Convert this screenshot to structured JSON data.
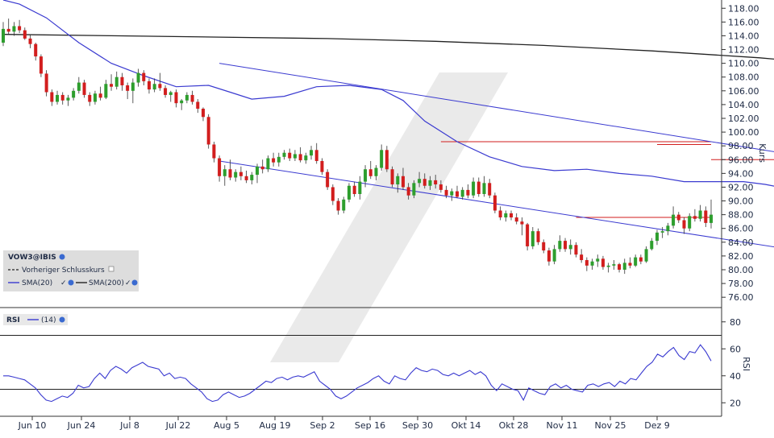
{
  "chart_data": {
    "type": "candlestick",
    "symbol_label": "VOW3@IBIS",
    "price_axis_title": "Kurs",
    "price_axis_ticks": [
      "76.00",
      "78.00",
      "80.00",
      "82.00",
      "84.00",
      "86.00",
      "88.00",
      "90.00",
      "92.00",
      "94.00",
      "96.00",
      "98.00",
      "100.00",
      "102.00",
      "104.00",
      "106.00",
      "108.00",
      "110.00",
      "112.00",
      "114.00",
      "116.00",
      "118.00"
    ],
    "price_ylim": [
      74.5,
      119.2
    ],
    "x_ticks": [
      "Jun 10",
      "Jun 24",
      "Jul 8",
      "Jul 22",
      "Aug 5",
      "Aug 19",
      "Sep 2",
      "Sep 16",
      "Sep 30",
      "Okt 14",
      "Okt 28",
      "Nov 11",
      "Nov 25",
      "Dez 9"
    ],
    "legend": {
      "prev_close": "Vorheriger Schlusskurs",
      "sma20": "SMA(20)",
      "sma200": "SMA(200)"
    },
    "colors": {
      "up": "#2e9e2e",
      "down": "#d21e1e",
      "sma20": "#3a3ad0",
      "sma200": "#222222",
      "channel": "#3a3ad0",
      "resistance": "#d21e1e",
      "rsi": "#3a3ad0"
    },
    "candles": [
      {
        "o": 113.0,
        "h": 116.0,
        "l": 112.5,
        "c": 115.0
      },
      {
        "o": 115.0,
        "h": 116.5,
        "l": 114.2,
        "c": 114.6
      },
      {
        "o": 114.6,
        "h": 116.0,
        "l": 114.0,
        "c": 115.4
      },
      {
        "o": 115.4,
        "h": 116.3,
        "l": 114.4,
        "c": 114.8
      },
      {
        "o": 114.8,
        "h": 115.2,
        "l": 113.4,
        "c": 113.6
      },
      {
        "o": 113.6,
        "h": 114.2,
        "l": 112.2,
        "c": 112.8
      },
      {
        "o": 112.8,
        "h": 113.0,
        "l": 110.4,
        "c": 111.0
      },
      {
        "o": 111.0,
        "h": 111.3,
        "l": 108.0,
        "c": 108.5
      },
      {
        "o": 108.5,
        "h": 109.0,
        "l": 105.2,
        "c": 105.8
      },
      {
        "o": 105.8,
        "h": 106.2,
        "l": 103.8,
        "c": 104.4
      },
      {
        "o": 104.4,
        "h": 106.0,
        "l": 104.0,
        "c": 105.4
      },
      {
        "o": 105.4,
        "h": 105.8,
        "l": 104.0,
        "c": 104.6
      },
      {
        "o": 104.6,
        "h": 105.4,
        "l": 103.8,
        "c": 105.0
      },
      {
        "o": 105.0,
        "h": 106.4,
        "l": 104.6,
        "c": 106.0
      },
      {
        "o": 106.0,
        "h": 108.0,
        "l": 105.6,
        "c": 107.2
      },
      {
        "o": 107.2,
        "h": 107.6,
        "l": 105.0,
        "c": 105.4
      },
      {
        "o": 105.4,
        "h": 105.8,
        "l": 103.8,
        "c": 104.4
      },
      {
        "o": 104.4,
        "h": 106.0,
        "l": 104.0,
        "c": 105.6
      },
      {
        "o": 105.6,
        "h": 106.6,
        "l": 104.6,
        "c": 105.0
      },
      {
        "o": 105.0,
        "h": 107.6,
        "l": 104.8,
        "c": 107.0
      },
      {
        "o": 107.0,
        "h": 108.4,
        "l": 106.0,
        "c": 106.6
      },
      {
        "o": 106.6,
        "h": 108.8,
        "l": 106.2,
        "c": 108.0
      },
      {
        "o": 108.0,
        "h": 108.6,
        "l": 106.0,
        "c": 106.8
      },
      {
        "o": 106.8,
        "h": 107.2,
        "l": 104.8,
        "c": 106.0
      },
      {
        "o": 106.0,
        "h": 107.8,
        "l": 104.2,
        "c": 107.2
      },
      {
        "o": 107.2,
        "h": 109.2,
        "l": 106.6,
        "c": 108.6
      },
      {
        "o": 108.6,
        "h": 109.0,
        "l": 106.8,
        "c": 107.4
      },
      {
        "o": 107.4,
        "h": 107.8,
        "l": 105.6,
        "c": 106.2
      },
      {
        "o": 106.2,
        "h": 107.8,
        "l": 105.8,
        "c": 107.0
      },
      {
        "o": 107.0,
        "h": 108.6,
        "l": 106.0,
        "c": 106.4
      },
      {
        "o": 106.4,
        "h": 106.8,
        "l": 105.0,
        "c": 105.4
      },
      {
        "o": 105.4,
        "h": 106.0,
        "l": 104.4,
        "c": 105.8
      },
      {
        "o": 105.8,
        "h": 106.2,
        "l": 103.6,
        "c": 104.2
      },
      {
        "o": 104.2,
        "h": 104.8,
        "l": 103.2,
        "c": 104.6
      },
      {
        "o": 104.6,
        "h": 105.8,
        "l": 104.2,
        "c": 105.4
      },
      {
        "o": 105.4,
        "h": 106.0,
        "l": 104.0,
        "c": 104.4
      },
      {
        "o": 104.4,
        "h": 104.8,
        "l": 102.8,
        "c": 103.4
      },
      {
        "o": 103.4,
        "h": 103.6,
        "l": 101.6,
        "c": 102.2
      },
      {
        "o": 102.2,
        "h": 102.6,
        "l": 97.6,
        "c": 98.2
      },
      {
        "o": 98.2,
        "h": 98.6,
        "l": 95.6,
        "c": 96.2
      },
      {
        "o": 96.2,
        "h": 96.6,
        "l": 92.8,
        "c": 93.6
      },
      {
        "o": 93.6,
        "h": 95.2,
        "l": 92.2,
        "c": 94.6
      },
      {
        "o": 94.6,
        "h": 96.0,
        "l": 93.0,
        "c": 93.4
      },
      {
        "o": 93.4,
        "h": 94.6,
        "l": 92.8,
        "c": 94.2
      },
      {
        "o": 94.2,
        "h": 95.0,
        "l": 93.0,
        "c": 93.6
      },
      {
        "o": 93.6,
        "h": 94.4,
        "l": 92.6,
        "c": 93.0
      },
      {
        "o": 93.0,
        "h": 94.2,
        "l": 92.4,
        "c": 93.8
      },
      {
        "o": 93.8,
        "h": 95.4,
        "l": 92.6,
        "c": 95.0
      },
      {
        "o": 95.0,
        "h": 96.0,
        "l": 94.0,
        "c": 94.6
      },
      {
        "o": 94.6,
        "h": 96.6,
        "l": 94.2,
        "c": 96.2
      },
      {
        "o": 96.2,
        "h": 97.0,
        "l": 95.0,
        "c": 95.6
      },
      {
        "o": 95.6,
        "h": 97.0,
        "l": 95.0,
        "c": 96.4
      },
      {
        "o": 96.4,
        "h": 97.4,
        "l": 96.0,
        "c": 97.0
      },
      {
        "o": 97.0,
        "h": 97.6,
        "l": 95.8,
        "c": 96.2
      },
      {
        "o": 96.2,
        "h": 97.4,
        "l": 95.8,
        "c": 96.8
      },
      {
        "o": 96.8,
        "h": 97.8,
        "l": 95.6,
        "c": 95.9
      },
      {
        "o": 95.9,
        "h": 97.0,
        "l": 95.4,
        "c": 96.6
      },
      {
        "o": 96.6,
        "h": 98.0,
        "l": 96.0,
        "c": 97.4
      },
      {
        "o": 97.4,
        "h": 98.4,
        "l": 95.4,
        "c": 95.8
      },
      {
        "o": 95.8,
        "h": 96.2,
        "l": 93.8,
        "c": 94.2
      },
      {
        "o": 94.2,
        "h": 94.6,
        "l": 91.6,
        "c": 92.0
      },
      {
        "o": 92.0,
        "h": 92.4,
        "l": 89.4,
        "c": 90.0
      },
      {
        "o": 90.0,
        "h": 90.4,
        "l": 88.0,
        "c": 88.6
      },
      {
        "o": 88.6,
        "h": 90.6,
        "l": 88.2,
        "c": 90.2
      },
      {
        "o": 90.2,
        "h": 92.6,
        "l": 89.8,
        "c": 92.2
      },
      {
        "o": 92.2,
        "h": 92.8,
        "l": 90.6,
        "c": 91.0
      },
      {
        "o": 91.0,
        "h": 93.6,
        "l": 90.2,
        "c": 92.8
      },
      {
        "o": 92.8,
        "h": 95.2,
        "l": 92.0,
        "c": 94.6
      },
      {
        "o": 94.6,
        "h": 95.8,
        "l": 93.2,
        "c": 93.6
      },
      {
        "o": 93.6,
        "h": 95.2,
        "l": 93.0,
        "c": 94.8
      },
      {
        "o": 94.8,
        "h": 98.2,
        "l": 94.4,
        "c": 97.4
      },
      {
        "o": 97.4,
        "h": 98.0,
        "l": 94.2,
        "c": 94.6
      },
      {
        "o": 94.6,
        "h": 95.0,
        "l": 92.0,
        "c": 92.4
      },
      {
        "o": 92.4,
        "h": 94.0,
        "l": 91.2,
        "c": 93.6
      },
      {
        "o": 93.6,
        "h": 94.8,
        "l": 91.6,
        "c": 92.0
      },
      {
        "o": 92.0,
        "h": 92.6,
        "l": 90.2,
        "c": 90.8
      },
      {
        "o": 90.8,
        "h": 93.0,
        "l": 90.4,
        "c": 92.6
      },
      {
        "o": 92.6,
        "h": 94.2,
        "l": 92.0,
        "c": 93.2
      },
      {
        "o": 93.2,
        "h": 94.0,
        "l": 91.8,
        "c": 92.2
      },
      {
        "o": 92.2,
        "h": 93.6,
        "l": 91.6,
        "c": 93.0
      },
      {
        "o": 93.0,
        "h": 93.8,
        "l": 91.8,
        "c": 92.4
      },
      {
        "o": 92.4,
        "h": 93.0,
        "l": 91.2,
        "c": 91.6
      },
      {
        "o": 91.6,
        "h": 92.2,
        "l": 90.4,
        "c": 90.8
      },
      {
        "o": 90.8,
        "h": 91.8,
        "l": 90.0,
        "c": 91.4
      },
      {
        "o": 91.4,
        "h": 92.2,
        "l": 90.4,
        "c": 90.6
      },
      {
        "o": 90.6,
        "h": 92.0,
        "l": 90.2,
        "c": 91.6
      },
      {
        "o": 91.6,
        "h": 92.4,
        "l": 90.4,
        "c": 90.8
      },
      {
        "o": 90.8,
        "h": 93.4,
        "l": 90.4,
        "c": 92.8
      },
      {
        "o": 92.8,
        "h": 93.4,
        "l": 90.6,
        "c": 91.0
      },
      {
        "o": 91.0,
        "h": 93.6,
        "l": 90.6,
        "c": 92.6
      },
      {
        "o": 92.6,
        "h": 93.2,
        "l": 90.4,
        "c": 90.8
      },
      {
        "o": 90.8,
        "h": 91.2,
        "l": 88.2,
        "c": 88.6
      },
      {
        "o": 88.6,
        "h": 89.2,
        "l": 87.2,
        "c": 87.6
      },
      {
        "o": 87.6,
        "h": 88.6,
        "l": 87.0,
        "c": 88.2
      },
      {
        "o": 88.2,
        "h": 88.6,
        "l": 87.2,
        "c": 87.6
      },
      {
        "o": 87.6,
        "h": 88.2,
        "l": 86.6,
        "c": 87.0
      },
      {
        "o": 87.0,
        "h": 87.6,
        "l": 85.0,
        "c": 86.6
      },
      {
        "o": 86.6,
        "h": 86.8,
        "l": 82.8,
        "c": 83.4
      },
      {
        "o": 83.4,
        "h": 86.2,
        "l": 83.0,
        "c": 85.6
      },
      {
        "o": 85.6,
        "h": 86.0,
        "l": 83.6,
        "c": 84.0
      },
      {
        "o": 84.0,
        "h": 84.4,
        "l": 82.4,
        "c": 82.8
      },
      {
        "o": 82.8,
        "h": 83.2,
        "l": 80.6,
        "c": 81.2
      },
      {
        "o": 81.2,
        "h": 83.6,
        "l": 80.8,
        "c": 83.0
      },
      {
        "o": 83.0,
        "h": 85.0,
        "l": 82.6,
        "c": 84.2
      },
      {
        "o": 84.2,
        "h": 84.6,
        "l": 82.6,
        "c": 83.0
      },
      {
        "o": 83.0,
        "h": 84.4,
        "l": 82.2,
        "c": 83.6
      },
      {
        "o": 83.6,
        "h": 84.0,
        "l": 81.8,
        "c": 82.2
      },
      {
        "o": 82.2,
        "h": 83.0,
        "l": 81.0,
        "c": 81.4
      },
      {
        "o": 81.4,
        "h": 81.8,
        "l": 79.8,
        "c": 80.6
      },
      {
        "o": 80.6,
        "h": 81.6,
        "l": 80.0,
        "c": 81.2
      },
      {
        "o": 81.2,
        "h": 82.2,
        "l": 80.4,
        "c": 81.6
      },
      {
        "o": 81.6,
        "h": 82.0,
        "l": 80.0,
        "c": 80.4
      },
      {
        "o": 80.4,
        "h": 81.0,
        "l": 79.6,
        "c": 80.6
      },
      {
        "o": 80.6,
        "h": 81.4,
        "l": 80.0,
        "c": 80.8
      },
      {
        "o": 80.8,
        "h": 81.0,
        "l": 79.6,
        "c": 80.0
      },
      {
        "o": 80.0,
        "h": 81.6,
        "l": 79.4,
        "c": 81.0
      },
      {
        "o": 81.0,
        "h": 81.8,
        "l": 80.2,
        "c": 80.6
      },
      {
        "o": 80.6,
        "h": 82.2,
        "l": 80.4,
        "c": 81.8
      },
      {
        "o": 81.8,
        "h": 82.2,
        "l": 80.8,
        "c": 81.2
      },
      {
        "o": 81.2,
        "h": 83.4,
        "l": 81.0,
        "c": 83.0
      },
      {
        "o": 83.0,
        "h": 84.6,
        "l": 82.8,
        "c": 84.2
      },
      {
        "o": 84.2,
        "h": 85.8,
        "l": 83.6,
        "c": 85.4
      },
      {
        "o": 85.4,
        "h": 86.2,
        "l": 84.6,
        "c": 85.6
      },
      {
        "o": 85.6,
        "h": 86.8,
        "l": 85.0,
        "c": 86.4
      },
      {
        "o": 86.4,
        "h": 89.2,
        "l": 86.0,
        "c": 88.0
      },
      {
        "o": 88.0,
        "h": 88.4,
        "l": 86.8,
        "c": 87.2
      },
      {
        "o": 87.2,
        "h": 87.6,
        "l": 85.2,
        "c": 86.0
      },
      {
        "o": 86.0,
        "h": 88.2,
        "l": 85.6,
        "c": 87.8
      },
      {
        "o": 87.8,
        "h": 88.8,
        "l": 87.0,
        "c": 87.4
      },
      {
        "o": 87.4,
        "h": 89.4,
        "l": 87.0,
        "c": 88.6
      },
      {
        "o": 88.6,
        "h": 89.2,
        "l": 86.2,
        "c": 86.8
      },
      {
        "o": 86.8,
        "h": 90.2,
        "l": 86.0,
        "c": 88.0
      }
    ],
    "sma20_points": [
      [
        0,
        119.2
      ],
      [
        3,
        118.6
      ],
      [
        8,
        116.6
      ],
      [
        14,
        113.0
      ],
      [
        20,
        110.0
      ],
      [
        26,
        108.2
      ],
      [
        32,
        106.6
      ],
      [
        38,
        106.8
      ],
      [
        42,
        105.8
      ],
      [
        46,
        104.8
      ],
      [
        52,
        105.2
      ],
      [
        58,
        106.6
      ],
      [
        64,
        106.8
      ],
      [
        70,
        106.2
      ],
      [
        74,
        104.6
      ],
      [
        78,
        101.6
      ],
      [
        84,
        98.6
      ],
      [
        90,
        96.4
      ],
      [
        96,
        95.0
      ],
      [
        102,
        94.4
      ],
      [
        108,
        94.6
      ],
      [
        114,
        94.0
      ],
      [
        120,
        93.6
      ],
      [
        126,
        92.8
      ],
      [
        131,
        92.8
      ],
      [
        137,
        92.8
      ],
      [
        141,
        92.4
      ],
      [
        145,
        91.8
      ],
      [
        150,
        91.6
      ],
      [
        154,
        91.2
      ],
      [
        158,
        90.0
      ],
      [
        164,
        88.4
      ],
      [
        170,
        86.8
      ],
      [
        176,
        84.8
      ],
      [
        182,
        83.2
      ],
      [
        188,
        82.4
      ],
      [
        194,
        82.2
      ],
      [
        200,
        82.6
      ],
      [
        205,
        83.2
      ],
      [
        211,
        84.2
      ]
    ],
    "sma200_points": [
      [
        0,
        114.2
      ],
      [
        20,
        114.0
      ],
      [
        40,
        113.8
      ],
      [
        60,
        113.6
      ],
      [
        80,
        113.2
      ],
      [
        100,
        112.6
      ],
      [
        120,
        111.8
      ],
      [
        140,
        110.8
      ],
      [
        160,
        109.4
      ],
      [
        170,
        108.4
      ],
      [
        180,
        107.0
      ],
      [
        190,
        105.2
      ],
      [
        200,
        103.2
      ],
      [
        211,
        101.8
      ]
    ],
    "channel_upper": [
      [
        40,
        110.0
      ],
      [
        211,
        88.6
      ]
    ],
    "channel_lower": [
      [
        40,
        95.8
      ],
      [
        211,
        75.0
      ]
    ],
    "resistance_lines": [
      {
        "level": 98.6,
        "from": 81,
        "to": 216
      },
      {
        "level": 98.2,
        "from": 121,
        "to": 216
      },
      {
        "level": 96.0,
        "from": 147,
        "to": 216
      },
      {
        "level": 87.6,
        "from": 106,
        "to": 216
      }
    ],
    "rsi": {
      "label": "RSI",
      "period": "(14)",
      "ticks": [
        "20",
        "40",
        "60",
        "80"
      ],
      "ylim": [
        10,
        90
      ],
      "levels": [
        30,
        70
      ],
      "values": [
        40,
        40,
        39,
        38,
        37,
        34,
        31,
        26,
        22,
        21,
        23,
        25,
        24,
        27,
        33,
        31,
        32,
        38,
        42,
        38,
        44,
        47,
        45,
        42,
        46,
        48,
        50,
        47,
        46,
        45,
        40,
        42,
        38,
        39,
        38,
        34,
        31,
        28,
        23,
        21,
        22,
        26,
        28,
        26,
        24,
        25,
        27,
        30,
        33,
        36,
        35,
        38,
        39,
        37,
        39,
        40,
        39,
        41,
        43,
        36,
        33,
        30,
        25,
        23,
        25,
        28,
        31,
        33,
        35,
        38,
        40,
        36,
        34,
        40,
        38,
        37,
        42,
        46,
        44,
        43,
        45,
        44,
        41,
        40,
        42,
        40,
        42,
        44,
        41,
        43,
        40,
        33,
        29,
        34,
        32,
        30,
        29,
        22,
        31,
        29,
        27,
        26,
        32,
        34,
        31,
        33,
        30,
        29,
        28,
        33,
        34,
        32,
        34,
        35,
        32,
        36,
        34,
        38,
        37,
        42,
        47,
        50,
        56,
        54,
        58,
        61,
        55,
        52,
        58,
        57,
        63,
        58,
        51
      ]
    }
  }
}
